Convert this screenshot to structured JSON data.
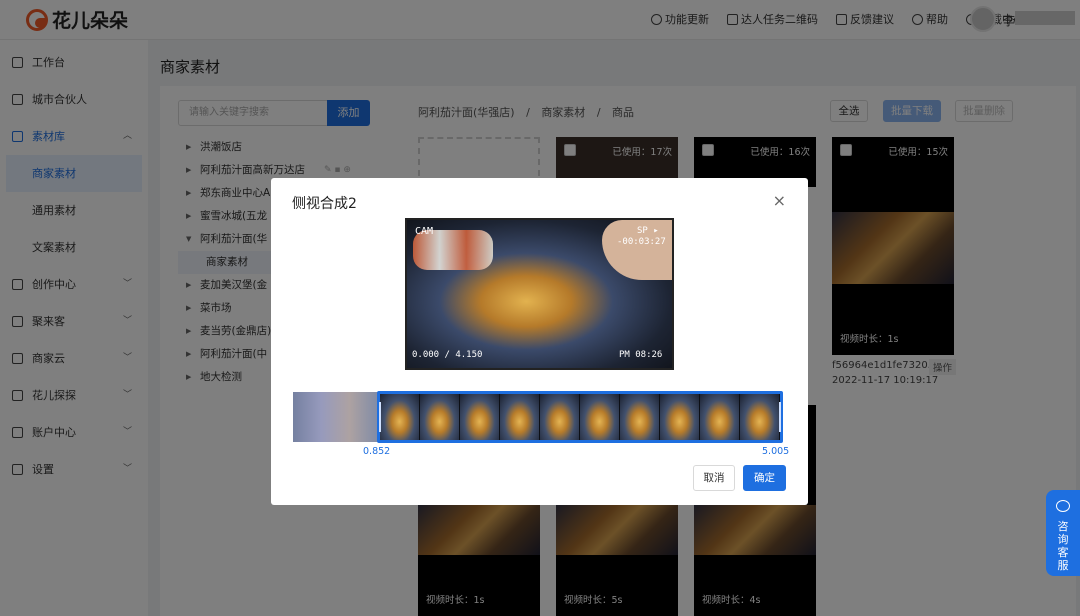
{
  "app": {
    "brand": "花儿朵朵"
  },
  "header": {
    "nav": [
      "功能更新",
      "达人任务二维码",
      "反馈建议",
      "帮助",
      "下载中心"
    ],
    "user": "李"
  },
  "sidebar": {
    "items": [
      {
        "label": "工作台",
        "icon": "desktop-icon"
      },
      {
        "label": "城市合伙人",
        "icon": "partner-icon"
      },
      {
        "label": "素材库",
        "icon": "image-icon",
        "expanded": true
      },
      {
        "label": "创作中心",
        "icon": "video-icon"
      },
      {
        "label": "聚来客",
        "icon": "gather-icon"
      },
      {
        "label": "商家云",
        "icon": "store-icon"
      },
      {
        "label": "花儿探探",
        "icon": "explore-icon"
      },
      {
        "label": "账户中心",
        "icon": "account-icon"
      },
      {
        "label": "设置",
        "icon": "gear-icon"
      }
    ],
    "sub": [
      "商家素材",
      "通用素材",
      "文案素材"
    ],
    "active_sub": "商家素材"
  },
  "page": {
    "title": "商家素材"
  },
  "search": {
    "placeholder": "请输入关键字搜索",
    "button": "添加"
  },
  "tree": {
    "nodes": [
      "洪潮饭店",
      "阿利茄汁面高新万达店",
      "郑东商业中心A",
      "蜜雪冰城(五龙",
      "阿利茄汁面(华",
      "麦加美汉堡(金",
      "菜市场",
      "麦当劳(金鼎店)",
      "阿利茄汁面(中",
      "地大检测"
    ],
    "child": "商家素材"
  },
  "breadcrumb": {
    "a": "阿利茄汁面(华强店)",
    "b": "商家素材",
    "c": "商品",
    "sep": "/"
  },
  "toolbar": {
    "select_all": "全选",
    "batch_download": "批量下载",
    "batch_delete": "批量删除"
  },
  "cards": {
    "c1": {
      "used": "已使用：17次"
    },
    "c2": {
      "used": "已使用：16次"
    },
    "c3": {
      "used": "已使用：15次",
      "duration": "视频时长：1s",
      "name": "f56964e1d1fe7320...",
      "action": "操作",
      "date": "2022-11-17 10:19:17"
    },
    "b1": {
      "duration": "视频时长：1s"
    },
    "b2": {
      "duration": "视频时长：5s"
    },
    "b3": {
      "duration": "视频时长：4s"
    }
  },
  "dialog": {
    "title": "侧视合成2",
    "close": "×",
    "overlay": {
      "cam": "CAM",
      "sp": "SP ▸",
      "tc": "-00:03:27",
      "left_bottom": "0.000 / 4.150",
      "right_bottom": "PM 08:26"
    },
    "range_start": "0.852",
    "range_end": "5.005",
    "cancel": "取消",
    "confirm": "确定"
  },
  "support": {
    "label": "咨询客服"
  },
  "colors": {
    "primary": "#1e6fe0",
    "brand": "#f05a28"
  }
}
